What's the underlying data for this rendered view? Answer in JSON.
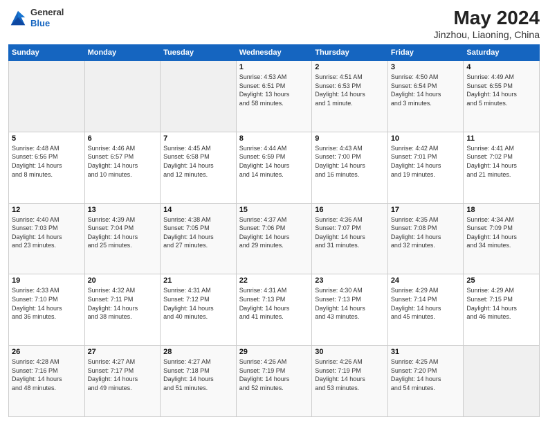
{
  "header": {
    "logo_line1": "General",
    "logo_line2": "Blue",
    "month_year": "May 2024",
    "location": "Jinzhou, Liaoning, China"
  },
  "days_of_week": [
    "Sunday",
    "Monday",
    "Tuesday",
    "Wednesday",
    "Thursday",
    "Friday",
    "Saturday"
  ],
  "weeks": [
    [
      {
        "num": "",
        "detail": ""
      },
      {
        "num": "",
        "detail": ""
      },
      {
        "num": "",
        "detail": ""
      },
      {
        "num": "1",
        "detail": "Sunrise: 4:53 AM\nSunset: 6:51 PM\nDaylight: 13 hours\nand 58 minutes."
      },
      {
        "num": "2",
        "detail": "Sunrise: 4:51 AM\nSunset: 6:53 PM\nDaylight: 14 hours\nand 1 minute."
      },
      {
        "num": "3",
        "detail": "Sunrise: 4:50 AM\nSunset: 6:54 PM\nDaylight: 14 hours\nand 3 minutes."
      },
      {
        "num": "4",
        "detail": "Sunrise: 4:49 AM\nSunset: 6:55 PM\nDaylight: 14 hours\nand 5 minutes."
      }
    ],
    [
      {
        "num": "5",
        "detail": "Sunrise: 4:48 AM\nSunset: 6:56 PM\nDaylight: 14 hours\nand 8 minutes."
      },
      {
        "num": "6",
        "detail": "Sunrise: 4:46 AM\nSunset: 6:57 PM\nDaylight: 14 hours\nand 10 minutes."
      },
      {
        "num": "7",
        "detail": "Sunrise: 4:45 AM\nSunset: 6:58 PM\nDaylight: 14 hours\nand 12 minutes."
      },
      {
        "num": "8",
        "detail": "Sunrise: 4:44 AM\nSunset: 6:59 PM\nDaylight: 14 hours\nand 14 minutes."
      },
      {
        "num": "9",
        "detail": "Sunrise: 4:43 AM\nSunset: 7:00 PM\nDaylight: 14 hours\nand 16 minutes."
      },
      {
        "num": "10",
        "detail": "Sunrise: 4:42 AM\nSunset: 7:01 PM\nDaylight: 14 hours\nand 19 minutes."
      },
      {
        "num": "11",
        "detail": "Sunrise: 4:41 AM\nSunset: 7:02 PM\nDaylight: 14 hours\nand 21 minutes."
      }
    ],
    [
      {
        "num": "12",
        "detail": "Sunrise: 4:40 AM\nSunset: 7:03 PM\nDaylight: 14 hours\nand 23 minutes."
      },
      {
        "num": "13",
        "detail": "Sunrise: 4:39 AM\nSunset: 7:04 PM\nDaylight: 14 hours\nand 25 minutes."
      },
      {
        "num": "14",
        "detail": "Sunrise: 4:38 AM\nSunset: 7:05 PM\nDaylight: 14 hours\nand 27 minutes."
      },
      {
        "num": "15",
        "detail": "Sunrise: 4:37 AM\nSunset: 7:06 PM\nDaylight: 14 hours\nand 29 minutes."
      },
      {
        "num": "16",
        "detail": "Sunrise: 4:36 AM\nSunset: 7:07 PM\nDaylight: 14 hours\nand 31 minutes."
      },
      {
        "num": "17",
        "detail": "Sunrise: 4:35 AM\nSunset: 7:08 PM\nDaylight: 14 hours\nand 32 minutes."
      },
      {
        "num": "18",
        "detail": "Sunrise: 4:34 AM\nSunset: 7:09 PM\nDaylight: 14 hours\nand 34 minutes."
      }
    ],
    [
      {
        "num": "19",
        "detail": "Sunrise: 4:33 AM\nSunset: 7:10 PM\nDaylight: 14 hours\nand 36 minutes."
      },
      {
        "num": "20",
        "detail": "Sunrise: 4:32 AM\nSunset: 7:11 PM\nDaylight: 14 hours\nand 38 minutes."
      },
      {
        "num": "21",
        "detail": "Sunrise: 4:31 AM\nSunset: 7:12 PM\nDaylight: 14 hours\nand 40 minutes."
      },
      {
        "num": "22",
        "detail": "Sunrise: 4:31 AM\nSunset: 7:13 PM\nDaylight: 14 hours\nand 41 minutes."
      },
      {
        "num": "23",
        "detail": "Sunrise: 4:30 AM\nSunset: 7:13 PM\nDaylight: 14 hours\nand 43 minutes."
      },
      {
        "num": "24",
        "detail": "Sunrise: 4:29 AM\nSunset: 7:14 PM\nDaylight: 14 hours\nand 45 minutes."
      },
      {
        "num": "25",
        "detail": "Sunrise: 4:29 AM\nSunset: 7:15 PM\nDaylight: 14 hours\nand 46 minutes."
      }
    ],
    [
      {
        "num": "26",
        "detail": "Sunrise: 4:28 AM\nSunset: 7:16 PM\nDaylight: 14 hours\nand 48 minutes."
      },
      {
        "num": "27",
        "detail": "Sunrise: 4:27 AM\nSunset: 7:17 PM\nDaylight: 14 hours\nand 49 minutes."
      },
      {
        "num": "28",
        "detail": "Sunrise: 4:27 AM\nSunset: 7:18 PM\nDaylight: 14 hours\nand 51 minutes."
      },
      {
        "num": "29",
        "detail": "Sunrise: 4:26 AM\nSunset: 7:19 PM\nDaylight: 14 hours\nand 52 minutes."
      },
      {
        "num": "30",
        "detail": "Sunrise: 4:26 AM\nSunset: 7:19 PM\nDaylight: 14 hours\nand 53 minutes."
      },
      {
        "num": "31",
        "detail": "Sunrise: 4:25 AM\nSunset: 7:20 PM\nDaylight: 14 hours\nand 54 minutes."
      },
      {
        "num": "",
        "detail": ""
      }
    ]
  ]
}
